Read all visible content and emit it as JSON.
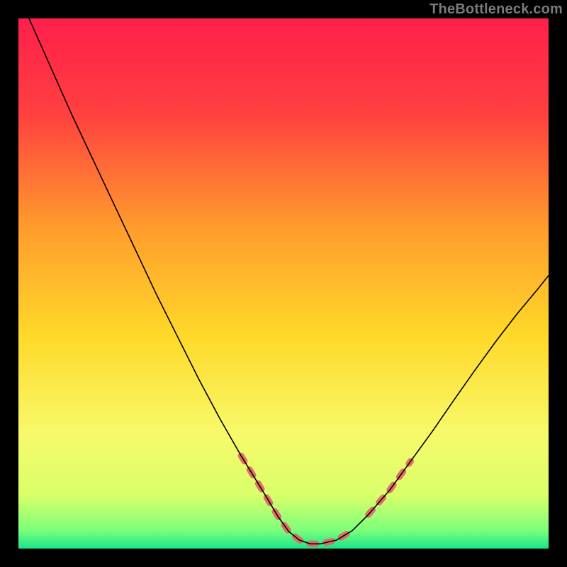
{
  "watermark": "TheBottleneck.com",
  "chart_data": {
    "type": "line",
    "title": "",
    "xlabel": "",
    "ylabel": "",
    "xlim": [
      0,
      100
    ],
    "ylim": [
      0,
      100
    ],
    "grid": false,
    "legend": false,
    "background": {
      "gradient_stops": [
        {
          "offset": 0.0,
          "color": "#ff1f4b"
        },
        {
          "offset": 0.18,
          "color": "#ff4040"
        },
        {
          "offset": 0.4,
          "color": "#ff9e2c"
        },
        {
          "offset": 0.6,
          "color": "#ffd92a"
        },
        {
          "offset": 0.78,
          "color": "#f8f96a"
        },
        {
          "offset": 0.9,
          "color": "#d9ff6a"
        },
        {
          "offset": 0.965,
          "color": "#7dff7a"
        },
        {
          "offset": 1.0,
          "color": "#19e68a"
        }
      ]
    },
    "series": [
      {
        "name": "bottleneck-curve",
        "color": "#000000",
        "width": 1.6,
        "x": [
          2,
          6,
          10,
          14,
          18,
          22,
          26,
          30,
          34,
          38,
          42,
          46,
          49,
          51,
          53,
          55,
          57,
          60,
          63,
          66,
          70,
          74,
          78,
          82,
          86,
          90,
          94,
          98,
          100
        ],
        "y": [
          100,
          91,
          82,
          73.5,
          65,
          56.5,
          48,
          40,
          32,
          24.5,
          17.5,
          11,
          6,
          3.2,
          1.6,
          0.9,
          0.9,
          1.6,
          3.4,
          6.4,
          11,
          16.5,
          22,
          27.8,
          33.5,
          39,
          44.2,
          49,
          51.5
        ]
      }
    ],
    "highlight_band": {
      "name": "recommended-range",
      "color": "#e16565",
      "dash": "9 14",
      "width": 9,
      "x": [
        22,
        26,
        30,
        34,
        38,
        42,
        46,
        49,
        51,
        53,
        55,
        57,
        60,
        63,
        66,
        70,
        74
      ],
      "y": [
        56.5,
        48,
        40,
        32,
        24.5,
        17.5,
        11,
        6,
        3.2,
        1.6,
        0.9,
        0.9,
        1.6,
        3.4,
        6.4,
        11,
        16.5
      ],
      "visible_segments": [
        {
          "start_index": 0,
          "end_index": 3
        },
        {
          "start_index": 5,
          "end_index": 13
        },
        {
          "start_index": 14,
          "end_index": 16
        }
      ]
    }
  }
}
